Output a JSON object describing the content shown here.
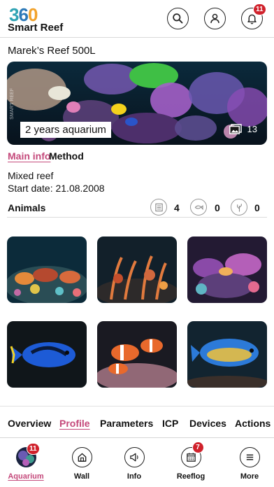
{
  "header": {
    "logo_digits": [
      "3",
      "6",
      "0"
    ],
    "logo_text": "Smart Reef",
    "notification_count": "11",
    "icons": [
      "search-icon",
      "user-icon",
      "bell-icon"
    ]
  },
  "aquarium": {
    "title": "Marek’s Reef 500L",
    "hero_caption": "2 years aquarium",
    "photo_count": "13",
    "hero_side_text": "SMART REEF"
  },
  "subtabs": [
    {
      "label": "Main info",
      "active": true
    },
    {
      "label": "Method",
      "active": false
    }
  ],
  "info": {
    "type": "Mixed reef",
    "start_date": "Start date: 21.08.2008"
  },
  "animals": {
    "label": "Animals",
    "stats": [
      {
        "icon": "list-icon",
        "value": "4"
      },
      {
        "icon": "fish-icon",
        "value": "0"
      },
      {
        "icon": "coral-icon",
        "value": "0"
      }
    ]
  },
  "gallery": [
    {
      "name": "reef-photo-1"
    },
    {
      "name": "reef-photo-2"
    },
    {
      "name": "reef-photo-3"
    },
    {
      "name": "blue-tang-photo"
    },
    {
      "name": "clownfish-photo"
    },
    {
      "name": "tang-photo"
    }
  ],
  "section_tabs": [
    {
      "label": "Overview",
      "active": false
    },
    {
      "label": "Profile",
      "active": true
    },
    {
      "label": "Parameters",
      "active": false
    },
    {
      "label": "ICP",
      "active": false
    },
    {
      "label": "Devices",
      "active": false
    },
    {
      "label": "Actions",
      "active": false
    }
  ],
  "bottom_nav": [
    {
      "label": "Aquarium",
      "active": true,
      "badge": "11"
    },
    {
      "label": "Wall",
      "active": false
    },
    {
      "label": "Info",
      "active": false
    },
    {
      "label": "Reeflog",
      "active": false,
      "badge": "7"
    },
    {
      "label": "More",
      "active": false
    }
  ],
  "colors": {
    "accent": "#c4487a",
    "badge": "#d0212b",
    "logo_3": "#2fa3b4",
    "logo_6": "#2c79b8",
    "logo_0": "#f2a22b"
  }
}
